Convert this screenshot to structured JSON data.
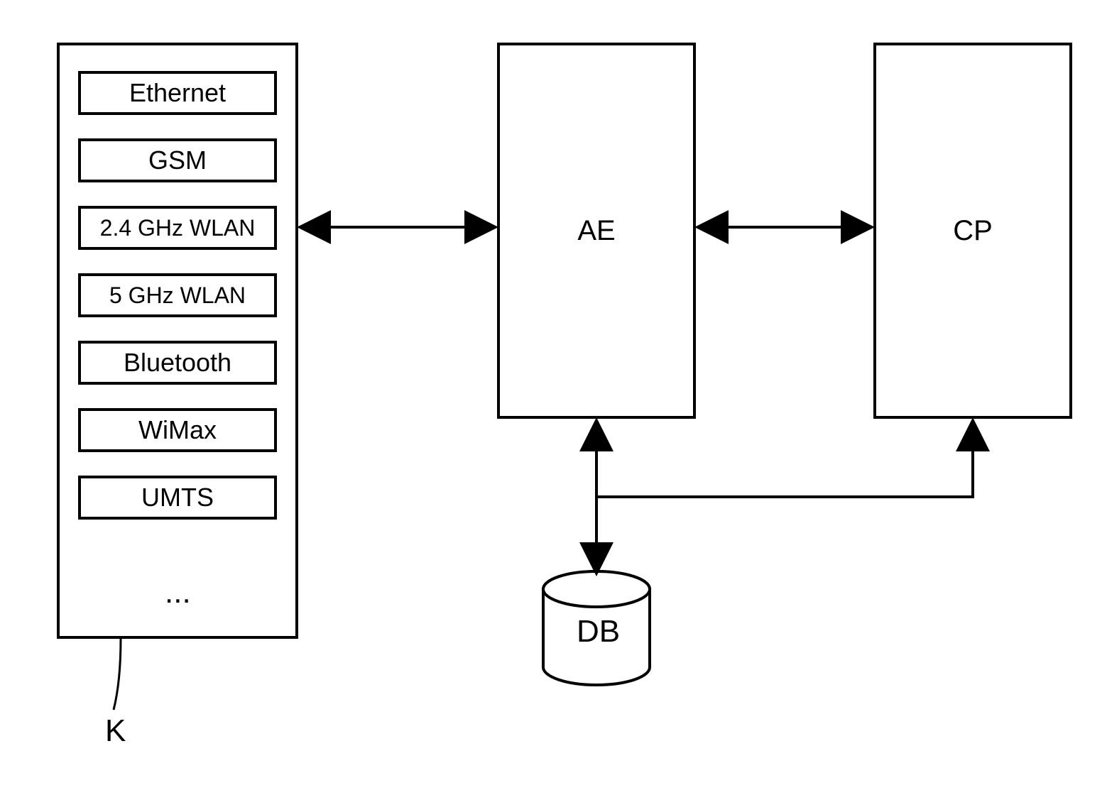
{
  "protocols": {
    "items": [
      "Ethernet",
      "GSM",
      "2.4 GHz WLAN",
      "5 GHz WLAN",
      "Bluetooth",
      "WiMax",
      "UMTS"
    ],
    "ellipsis": "...",
    "reference": "K"
  },
  "blocks": {
    "ae": "AE",
    "cp": "CP",
    "db": "DB"
  }
}
